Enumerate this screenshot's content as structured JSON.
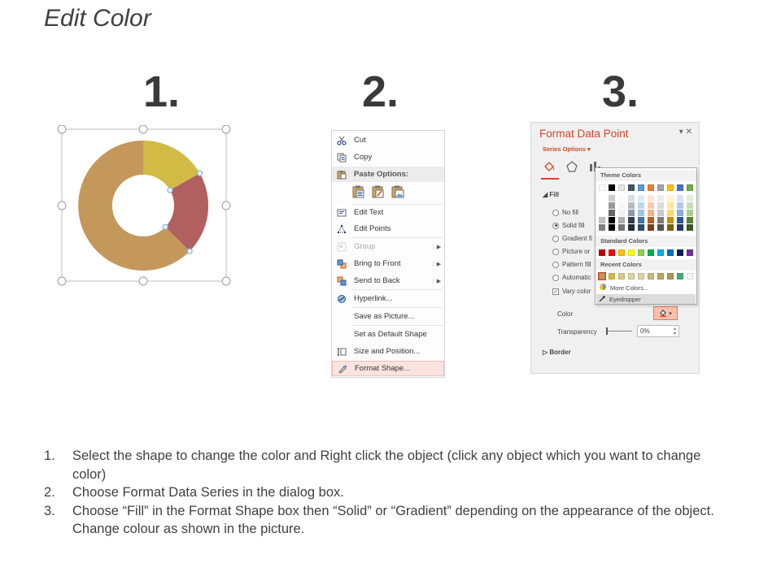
{
  "slide": {
    "title": "Edit Color",
    "step_numbers": [
      "1.",
      "2.",
      "3."
    ]
  },
  "donut": {
    "segment_colors": [
      "#c3985a",
      "#d1bb45",
      "#b2605f"
    ],
    "handle_color": "#7fb5e3"
  },
  "context_menu": {
    "cut": "Cut",
    "copy": "Copy",
    "paste_options": "Paste Options:",
    "edit_text": "Edit Text",
    "edit_points": "Edit Points",
    "group": "Group",
    "bring_to_front": "Bring to Front",
    "send_to_back": "Send to Back",
    "hyperlink": "Hyperlink...",
    "save_as_picture": "Save as Picture...",
    "set_default_shape": "Set as Default Shape",
    "size_and_position": "Size and Position...",
    "format_shape": "Format Shape..."
  },
  "format_pane": {
    "title": "Format Data Point",
    "series_options": "Series Options",
    "fill_section": "Fill",
    "options": {
      "no_fill": "No fill",
      "solid_fill": "Solid fill",
      "gradient_fill": "Gradient fi",
      "picture_fill": "Picture or",
      "pattern_fill": "Pattern fill",
      "automatic": "Automatic",
      "vary_colors": "Vary color"
    },
    "color_label": "Color",
    "transparency_label": "Transparency",
    "transparency_value": "0%",
    "border_section": "Border",
    "accent_color": "#d24726"
  },
  "color_dropdown": {
    "theme_colors_label": "Theme Colors",
    "standard_colors_label": "Standard Colors",
    "recent_colors_label": "Recent Colors",
    "more_colors": "More Colors...",
    "eyedropper": "Eyedropper",
    "theme_colors": [
      "#ffffff",
      "#000000",
      "#e7e6e6",
      "#44546a",
      "#5b9bd5",
      "#ed7d31",
      "#a5a5a5",
      "#ffc000",
      "#4472c4",
      "#70ad47"
    ],
    "standard_colors": [
      "#c00000",
      "#ff0000",
      "#ffc000",
      "#ffff00",
      "#92d050",
      "#00b050",
      "#00b0f0",
      "#0070c0",
      "#002060",
      "#7030a0"
    ],
    "recent_colors": [
      "#c3985a",
      "#d1bb45",
      "#d6c98a",
      "#d9d4a2",
      "#dcd3a0",
      "#c8bb7a",
      "#b8a860",
      "#a89a58",
      "#4cab79",
      "#f5f5f5"
    ]
  },
  "instructions": [
    {
      "num": "1.",
      "text": "Select the shape to change the color and Right click the object (click any object which you want to change color)"
    },
    {
      "num": "2.",
      "text": "Choose Format Data Series in the dialog box."
    },
    {
      "num": "3.",
      "text": "Choose “Fill” in the Format Shape box then “Solid” or “Gradient” depending on the appearance of the object. Change colour as shown in the picture."
    }
  ]
}
